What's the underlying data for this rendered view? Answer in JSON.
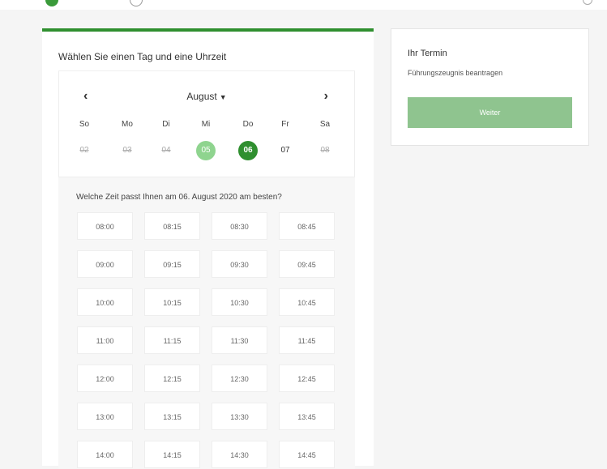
{
  "main": {
    "title": "Wählen Sie einen Tag und eine Uhrzeit",
    "calendar": {
      "month": "August",
      "weekdays": [
        "So",
        "Mo",
        "Di",
        "Mi",
        "Do",
        "Fr",
        "Sa"
      ],
      "days": [
        {
          "label": "02",
          "state": "disabled"
        },
        {
          "label": "03",
          "state": "disabled"
        },
        {
          "label": "04",
          "state": "disabled"
        },
        {
          "label": "05",
          "state": "today"
        },
        {
          "label": "06",
          "state": "selected"
        },
        {
          "label": "07",
          "state": "available"
        },
        {
          "label": "08",
          "state": "disabled"
        }
      ]
    },
    "time_question": "Welche Zeit passt Ihnen am 06. August 2020 am besten?",
    "time_slots": [
      [
        "08:00",
        "08:15",
        "08:30",
        "08:45"
      ],
      [
        "09:00",
        "09:15",
        "09:30",
        "09:45"
      ],
      [
        "10:00",
        "10:15",
        "10:30",
        "10:45"
      ],
      [
        "11:00",
        "11:15",
        "11:30",
        "11:45"
      ],
      [
        "12:00",
        "12:15",
        "12:30",
        "12:45"
      ],
      [
        "13:00",
        "13:15",
        "13:30",
        "13:45"
      ],
      [
        "14:00",
        "14:15",
        "14:30",
        "14:45"
      ]
    ]
  },
  "side": {
    "title": "Ihr Termin",
    "subtitle": "Führungszeugnis beantragen",
    "button": "Weiter"
  },
  "colors": {
    "accent": "#2f8f2f",
    "accent_light": "#8fd48f",
    "button": "#8fc48f"
  },
  "icons": {
    "prev": "chevron-left-icon",
    "next": "chevron-right-icon",
    "month_dropdown": "chevron-down-icon"
  }
}
